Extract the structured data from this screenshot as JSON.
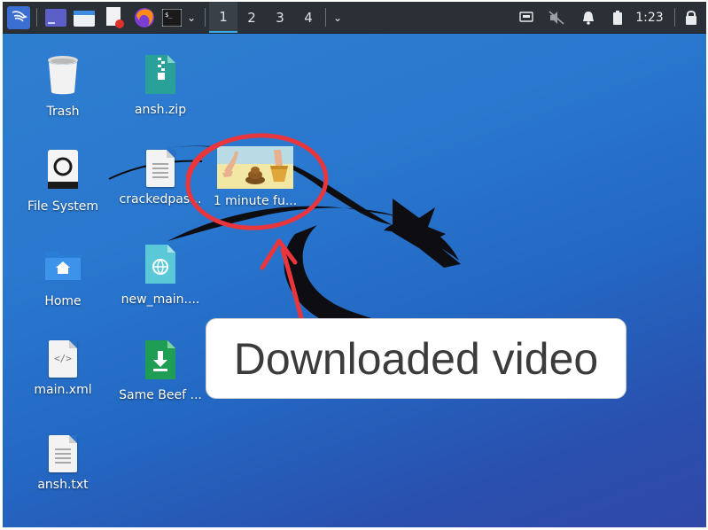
{
  "taskbar": {
    "desktops": [
      "1",
      "2",
      "3",
      "4"
    ],
    "clock": "1:23",
    "icons": [
      "kali-menu-icon",
      "terminal-preview-icon",
      "file-manager-icon",
      "text-editor-icon",
      "firefox-icon",
      "terminal-icon",
      "chevron-down-icon",
      "network-icon",
      "muted-speaker-icon",
      "bell-icon",
      "battery-icon",
      "lock-icon"
    ]
  },
  "desktop": {
    "icons": [
      {
        "label": "Trash",
        "icon": "trash-icon"
      },
      {
        "label": "ansh.zip",
        "icon": "zip-archive-icon"
      },
      {
        "label": "File System",
        "icon": "drive-icon"
      },
      {
        "label": "crackedpas...",
        "icon": "text-file-icon"
      },
      {
        "label": "1 minute fu...",
        "icon": "video-thumbnail-icon"
      },
      {
        "label": "Home",
        "icon": "home-folder-icon"
      },
      {
        "label": "new_main....",
        "icon": "html-file-icon"
      },
      {
        "label": "main.xml",
        "icon": "xml-file-icon"
      },
      {
        "label": "Same Beef ...",
        "icon": "installer-file-icon"
      },
      {
        "label": "ansh.txt",
        "icon": "text-file-icon"
      }
    ]
  },
  "annotation": {
    "callout_text": "Downloaded video",
    "highlight_color": "#e8363c"
  },
  "colors": {
    "desktop_top": "#2f7fd0",
    "desktop_bottom": "#3048a8",
    "taskbar": "#2b3036",
    "accent": "#3daee9"
  }
}
